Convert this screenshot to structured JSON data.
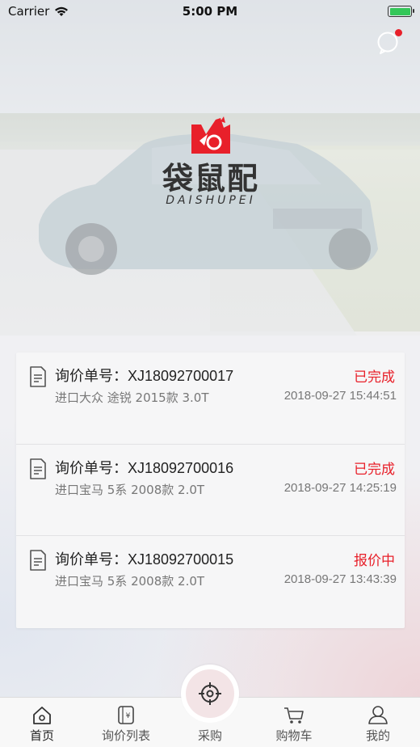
{
  "status_bar": {
    "carrier": "Carrier",
    "time": "5:00 PM"
  },
  "brand": {
    "name_cn": "袋鼠配",
    "name_en": "DAISHUPEI",
    "accent_color": "#e8202a"
  },
  "inquiries": [
    {
      "label": "询价单号：XJ18092700017",
      "status": "已完成",
      "car": "进口大众 途锐 2015款 3.0T",
      "time": "2018-09-27 15:44:51"
    },
    {
      "label": "询价单号：XJ18092700016",
      "status": "已完成",
      "car": "进口宝马 5系 2008款 2.0T",
      "time": "2018-09-27 14:25:19"
    },
    {
      "label": "询价单号：XJ18092700015",
      "status": "报价中",
      "car": "进口宝马 5系 2008款 2.0T",
      "time": "2018-09-27 13:43:39"
    }
  ],
  "tabs": [
    {
      "label": "首页",
      "icon": "home-icon",
      "active": true
    },
    {
      "label": "询价列表",
      "icon": "quote-list-icon",
      "active": false
    },
    {
      "label": "采购",
      "icon": "scan-target-icon",
      "active": false
    },
    {
      "label": "购物车",
      "icon": "cart-icon",
      "active": false
    },
    {
      "label": "我的",
      "icon": "profile-icon",
      "active": false
    }
  ]
}
